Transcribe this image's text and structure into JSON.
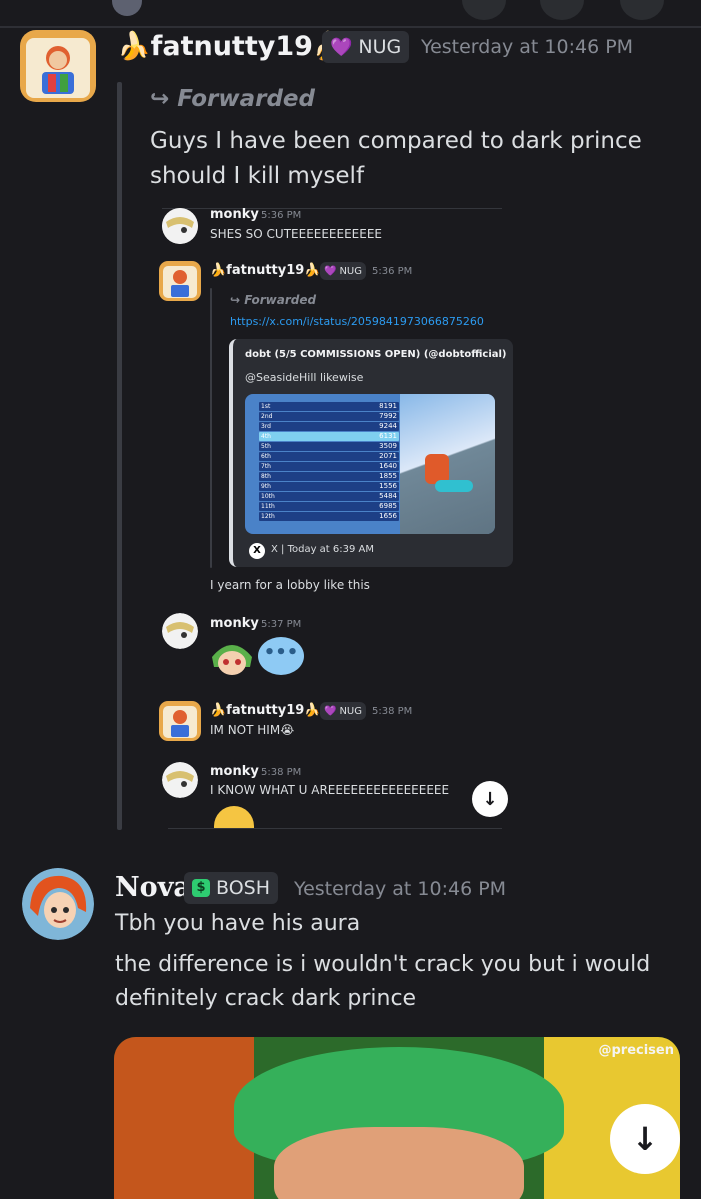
{
  "colors": {
    "background": "#1a1a1e",
    "link": "#2c9bf0",
    "badge_bg": "#2e3036",
    "nug_heart": "#c7a8ff",
    "bosh_icon": "#2ecc71"
  },
  "msg1": {
    "author": "🍌fatnutty19🍌",
    "badge_icon": "heart-icon",
    "badge": "NUG",
    "time": "Yesterday at 10:46 PM",
    "forwarded": "Forwarded",
    "text": "Guys I have been compared to dark prince should I kill myself",
    "screenshot": {
      "m1": {
        "author": "monky",
        "time": "5:36 PM",
        "text": "SHES SO CUTEEEEEEEEEEEE"
      },
      "m2": {
        "author": "🍌fatnutty19🍌",
        "badge": "NUG",
        "time": "5:36 PM",
        "forwarded": "Forwarded",
        "link": "https://x.com/i/status/2059841973066875260",
        "embed": {
          "author": "dobt (5/5 COMMISSIONS OPEN) (@dobtofficial)",
          "text": "@SeasideHill likewise",
          "footer": "X | Today at 6:39 AM",
          "scores": [
            "8191",
            "7992",
            "9244",
            "6131",
            "3509",
            "2071",
            "1640",
            "1855",
            "1556",
            "5484",
            "6985",
            "1656"
          ],
          "ranks": [
            "1st",
            "2nd",
            "3rd",
            "4th",
            "5th",
            "6th",
            "7th",
            "8th",
            "9th",
            "10th",
            "11th",
            "12th"
          ]
        },
        "caption": "I yearn for a lobby like this"
      },
      "m3": {
        "author": "monky",
        "time": "5:37 PM"
      },
      "m4": {
        "author": "🍌fatnutty19🍌",
        "badge": "NUG",
        "time": "5:38 PM",
        "text": "IM NOT HIM😭"
      },
      "m5": {
        "author": "monky",
        "time": "5:38 PM",
        "text": "I KNOW WHAT U AREEEEEEEEEEEEEEEE"
      }
    }
  },
  "msg2": {
    "author": "Nova",
    "badge_icon": "dollar-icon",
    "badge": "BOSH",
    "time": "Yesterday at 10:46 PM",
    "line1": "Tbh you have his aura",
    "line2": "the difference is i wouldn't crack you but i would definitely crack dark prince",
    "image_watermark": "@precisen"
  }
}
